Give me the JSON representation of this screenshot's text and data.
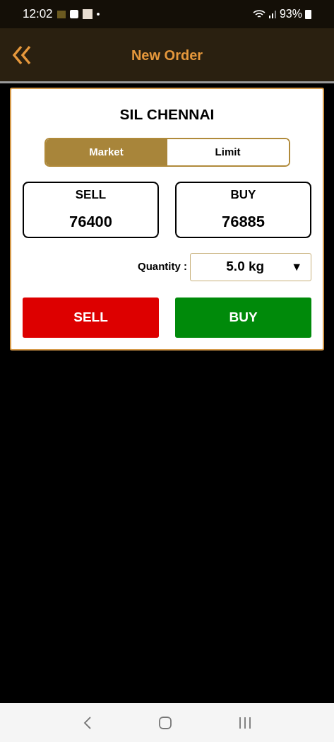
{
  "status_bar": {
    "time": "12:02",
    "battery": "93%"
  },
  "header": {
    "title": "New Order"
  },
  "order_card": {
    "title": "SIL CHENNAI",
    "tabs": [
      {
        "label": "Market",
        "selected": true
      },
      {
        "label": "Limit",
        "selected": false
      }
    ],
    "quotes": [
      {
        "label": "SELL",
        "price": "76400"
      },
      {
        "label": "BUY",
        "price": "76885"
      }
    ],
    "quantity": {
      "label": "Quantity :",
      "value": "5.0 kg",
      "arrow": "▼"
    },
    "actions": [
      {
        "label": "SELL",
        "kind": "sell"
      },
      {
        "label": "BUY",
        "kind": "buy"
      }
    ]
  }
}
